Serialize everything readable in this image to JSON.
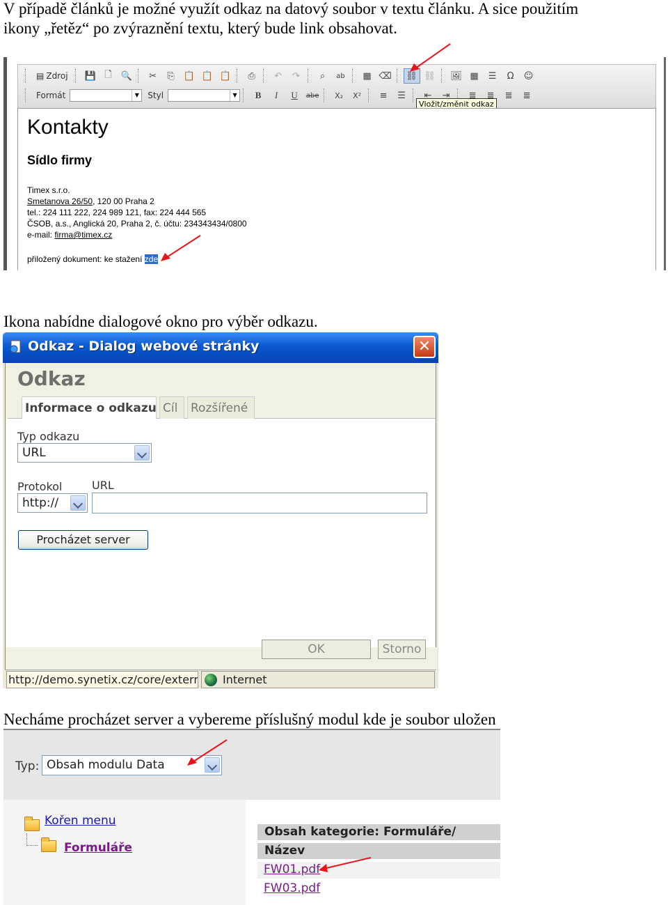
{
  "doc": {
    "para1_line1": "V případě článků je možné využít odkaz na datový soubor v textu článku. A sice použitím",
    "para1_line2": "ikony „řetěz“ po zvýraznění textu, který bude link obsahovat.",
    "para2": "Ikona nabídne dialogové okno pro výběr odkazu.",
    "para3": "Necháme procházet server a vybereme příslušný modul kde je soubor uložen"
  },
  "editor": {
    "toolbar": {
      "source_label": "Zdroj",
      "format_label": "Formát",
      "style_label": "Styl",
      "bold": "B",
      "italic": "I",
      "underline": "U",
      "strike": "abe",
      "subscript": "X₂",
      "superscript": "X²",
      "omega": "Ω"
    },
    "tooltip": "Vložit/změnit odkaz",
    "heading": "Kontakty",
    "subheading": "Sídlo firmy",
    "company": "Timex s.r.o.",
    "street_link": "Smetanova 26/50",
    "street_rest": ", 120 00 Praha 2",
    "phones": "tel.: 224 111 222, 224 989 121, fax: 224 444 565",
    "bank": "ČSOB, a.s., Anglická 20, Praha 2, č. účtu: 234343434/0800",
    "email_label": "e-mail: ",
    "email_link": "firma@timex.cz",
    "attachment_text": "přiložený dokument: ke stažení ",
    "attachment_selected": "zde"
  },
  "dialog": {
    "title": "Odkaz - Dialog webové stránky",
    "close_glyph": "✕",
    "heading": "Odkaz",
    "tabs": [
      "Informace o odkazu",
      "Cíl",
      "Rozšířené"
    ],
    "link_type_label": "Typ odkazu",
    "link_type_value": "URL",
    "protocol_label": "Protokol",
    "protocol_value": "http://",
    "url_label": "URL",
    "url_value": "",
    "browse_button": "Procházet server",
    "ok_button": "OK",
    "cancel_button": "Storno",
    "status_url": "http://demo.synetix.cz/core/extern",
    "status_zone": "Internet"
  },
  "browser": {
    "type_label": "Typ:",
    "type_value": "Obsah modulu Data",
    "tree_root": "Kořen menu",
    "tree_child": "Formuláře",
    "category_header": "Obsah kategorie: Formuláře/",
    "column_header": "Název",
    "files": [
      "FW01.pdf",
      "FW03.pdf"
    ]
  },
  "colors": {
    "arrow": "#e8141a",
    "xp_title": "#0a58d0",
    "selection": "#316ac5"
  }
}
